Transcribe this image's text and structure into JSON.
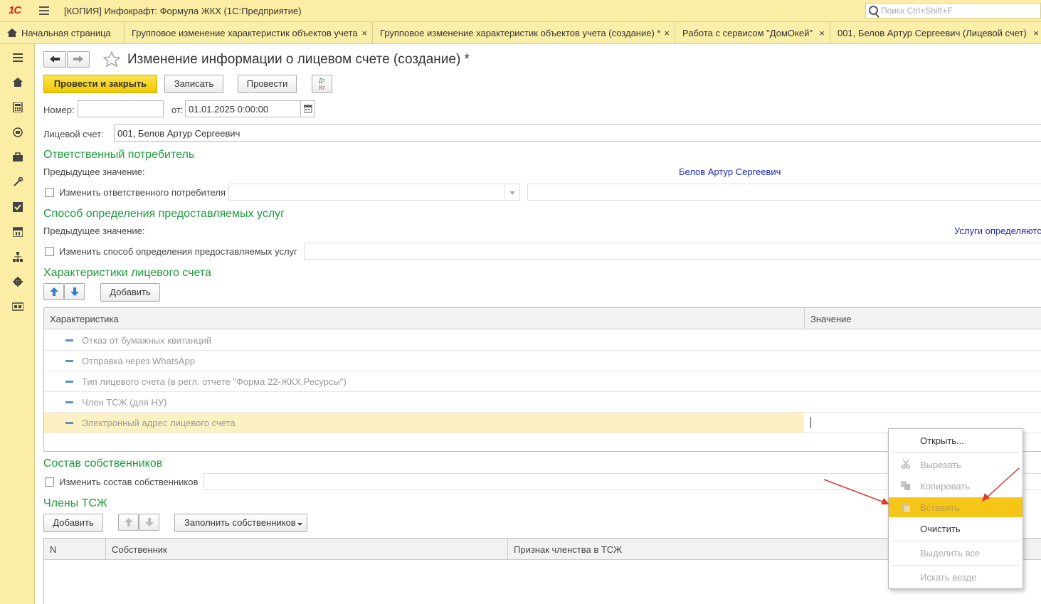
{
  "titlebar": {
    "logo": "1С",
    "title": "[КОПИЯ] Инфокрафт: Формула ЖКХ  (1С:Предприятие)",
    "search_placeholder": "Поиск Ctrl+Shift+F"
  },
  "tabs": [
    {
      "label": "Начальная страница"
    },
    {
      "label": "Групповое изменение характеристик объектов учета"
    },
    {
      "label": "Групповое изменение характеристик объектов учета (создание) *"
    },
    {
      "label": "Работа с сервисом \"ДомОкей\""
    },
    {
      "label": "001, Белов Артур Сергеевич (Лицевой счет)"
    }
  ],
  "tab_close": "×",
  "sidebar": {
    "icons": [
      "menu-icon",
      "home-icon",
      "calculator-icon",
      "meter-icon",
      "briefcase-icon",
      "tools-icon",
      "checkbox-icon",
      "calendar-icon",
      "structure-icon",
      "gear-icon",
      "card-icon"
    ]
  },
  "form": {
    "title": "Изменение информации о лицевом счете (создание) *",
    "toolbar": {
      "post_close": "Провести и закрыть",
      "save": "Записать",
      "post": "Провести",
      "dt_kt_top": "Дт",
      "dt_kt_bottom": "Кт"
    },
    "number_label": "Номер:",
    "number_value": "",
    "date_label": "от:",
    "date_value": "01.01.2025  0:00:00",
    "account_label": "Лицевой счет:",
    "account_value": "001, Белов Артур Сергеевич",
    "responsible": {
      "heading": "Ответственный потребитель",
      "prev_label": "Предыдущее значение:",
      "prev_value": "Белов Артур Сергеевич",
      "change_label": "Изменить ответственного потребителя",
      "checked": false
    },
    "services": {
      "heading": "Способ определения предоставляемых услуг",
      "prev_label": "Предыдущее значение:",
      "prev_value": "Услуги определяются",
      "change_label": "Изменить способ определения предоставляемых услуг",
      "checked": false
    },
    "characteristics": {
      "heading": "Характеристики лицевого счета",
      "add_button": "Добавить",
      "columns": [
        "Характеристика",
        "Значение"
      ],
      "rows": [
        "Отказ от бумажных квитанций",
        "Отправка через WhatsApp",
        "Тип лицевого счета (в регл. отчете \"Форма 22-ЖКХ.Ресурсы\")",
        "Член ТСЖ (для НУ)",
        "Электронный адрес лицевого счета"
      ],
      "selected_row": 4
    },
    "owners": {
      "heading": "Состав собственников",
      "change_label": "Изменить состав собственников",
      "checked": false
    },
    "hoa_members": {
      "heading": "Члены ТСЖ",
      "add_button": "Добавить",
      "fill_button": "Заполнить собственников",
      "columns": [
        "N",
        "Собственник",
        "Признак членства в ТСЖ"
      ]
    }
  },
  "context_menu": {
    "items": [
      {
        "label": "Открыть...",
        "disabled": false,
        "icon": ""
      },
      {
        "label": "Вырезать",
        "disabled": true,
        "icon": "scissors-icon"
      },
      {
        "label": "Копировать",
        "disabled": true,
        "icon": "copy-icon"
      },
      {
        "label": "Вставить",
        "disabled": true,
        "icon": "paste-icon",
        "highlighted": true
      },
      {
        "label": "Очистить",
        "disabled": false,
        "icon": ""
      },
      {
        "label": "Выделить все",
        "disabled": true,
        "icon": ""
      },
      {
        "label": "Искать везде",
        "disabled": true,
        "icon": ""
      }
    ]
  },
  "colors": {
    "accent_yellow": "#fbeea4",
    "section_green": "#1e9a3c",
    "link_blue": "#1a2bb8",
    "highlight": "#f5c518",
    "arrow_red": "#e0382f"
  }
}
